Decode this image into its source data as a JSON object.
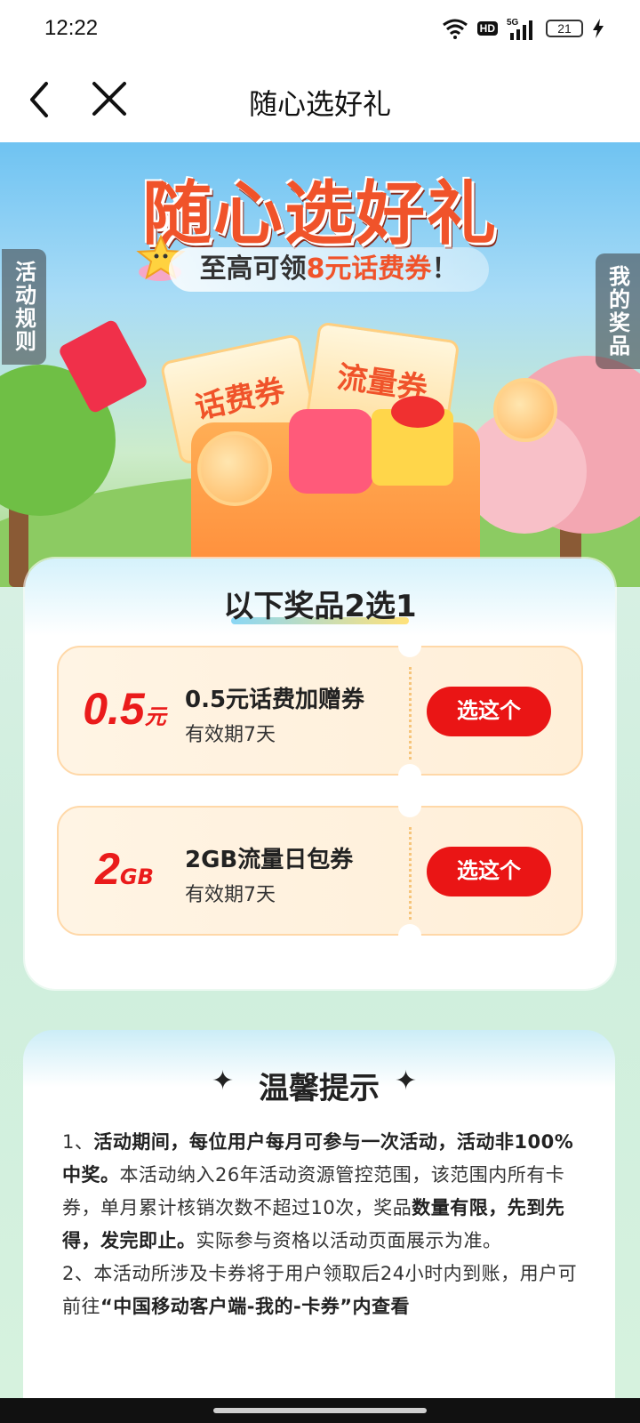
{
  "status_bar": {
    "time": "12:22",
    "hd_label": "HD",
    "network_label": "5G",
    "battery_level": "21"
  },
  "nav": {
    "title": "随心选好礼"
  },
  "hero": {
    "title": "随心选好礼",
    "subtitle_prefix": "至高可领",
    "subtitle_highlight": "8元话费券",
    "subtitle_suffix": "！",
    "voucher_left": "话费券",
    "voucher_right": "流量券",
    "side_tab_left": "活动规则",
    "side_tab_right": "我的奖品"
  },
  "prizes": {
    "heading": "以下奖品2选1",
    "options": [
      {
        "amount": "0.5",
        "unit": "元",
        "name": "0.5元话费加赠券",
        "validity": "有效期7天",
        "button": "选这个"
      },
      {
        "amount": "2",
        "unit": "GB",
        "name": "2GB流量日包券",
        "validity": "有效期7天",
        "button": "选这个"
      }
    ]
  },
  "tips": {
    "heading": "温馨提示",
    "p1_a": "1、",
    "p1_b": "活动期间，每位用户每月可参与一次活动，活动非100%中奖。",
    "p1_c": "本活动纳入26年活动资源管控范围，该范围内所有卡券，单月累计核销次数不超过10次，奖品",
    "p1_d": "数量有限，先到先得，发完即止。",
    "p1_e": "实际参与资格以活动页面展示为准。",
    "p2_a": "2、本活动所涉及卡券将于用户领取后24小时内到账，用户可前往",
    "p2_b": "“中国移动客户端-我的-卡券”内查看"
  },
  "colors": {
    "accent_red": "#ea1515",
    "hero_title": "#f0532a",
    "card_bg": "#fff4e4"
  }
}
